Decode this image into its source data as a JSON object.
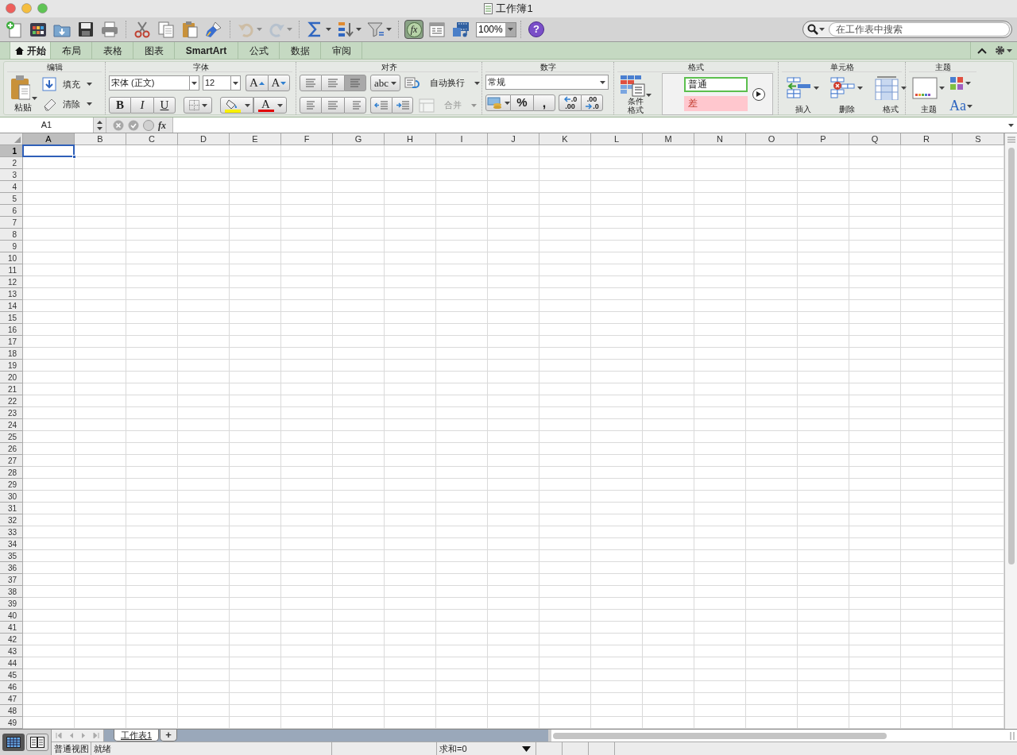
{
  "window": {
    "title": "工作簿1"
  },
  "toolbar": [
    {
      "kind": "new"
    },
    {
      "kind": "gallery"
    },
    {
      "kind": "open"
    },
    {
      "kind": "save"
    },
    {
      "kind": "print"
    },
    {
      "kind": "separator"
    },
    {
      "kind": "cut"
    },
    {
      "kind": "copy"
    },
    {
      "kind": "paste"
    },
    {
      "kind": "painter"
    },
    {
      "kind": "separator"
    },
    {
      "kind": "undo",
      "disabled": true
    },
    {
      "kind": "redo",
      "disabled": true
    },
    {
      "kind": "separator"
    },
    {
      "kind": "sum"
    },
    {
      "kind": "sort"
    },
    {
      "kind": "filter"
    },
    {
      "kind": "separator"
    },
    {
      "kind": "formula",
      "label": "fx",
      "on": true
    },
    {
      "kind": "toolbox"
    },
    {
      "kind": "media"
    },
    {
      "kind": "zoom",
      "value": "100%"
    },
    {
      "kind": "separator"
    },
    {
      "kind": "help",
      "label": "?"
    }
  ],
  "search": {
    "placeholder": "在工作表中搜索"
  },
  "tabs": [
    {
      "label": "开始",
      "selected": true
    },
    {
      "label": "布局",
      "selected": false
    },
    {
      "label": "表格",
      "selected": false
    },
    {
      "label": "图表",
      "selected": false
    },
    {
      "label": "SmartArt",
      "selected": false
    },
    {
      "label": "公式",
      "selected": false
    },
    {
      "label": "数据",
      "selected": false
    },
    {
      "label": "审阅",
      "selected": false
    }
  ],
  "ribbon": [
    {
      "kind": "edit",
      "label": "编辑",
      "paste": "粘贴",
      "fill": "填充",
      "clear": "清除"
    },
    {
      "kind": "font",
      "label": "字体",
      "font_name": "宋体 (正文)",
      "font_size": "12",
      "grow": "A",
      "shrink": "A",
      "bold": "B",
      "italic": "I",
      "underline": "U",
      "font_color": "A"
    },
    {
      "kind": "align",
      "label": "对齐",
      "vertical": [
        {
          "selected": false
        },
        {
          "selected": false
        },
        {
          "selected": true
        }
      ],
      "orientation": "abc",
      "wrap": "自动换行",
      "merge": "合并",
      "merge_disabled": true
    },
    {
      "kind": "number",
      "label": "数字",
      "format": "常规",
      "percent": "%",
      "comma": ",",
      "decrease_decimal": [
        ".0",
        ".00"
      ],
      "increase_decimal": [
        ".00",
        ".0"
      ]
    },
    {
      "kind": "styles",
      "label": "格式",
      "conditional": "条件格式",
      "styles": [
        {
          "kind": "normal",
          "label": "普通"
        },
        {
          "kind": "bad",
          "label": "差"
        }
      ]
    },
    {
      "kind": "cells",
      "label": "单元格",
      "insert": "插入",
      "delete": "删除",
      "format": "格式"
    },
    {
      "kind": "themes",
      "label": "主题",
      "themes": "主题",
      "fonts": "Aa"
    }
  ],
  "formula_bar": {
    "name_box": "A1",
    "fx": "fx"
  },
  "columns": [
    {
      "label": "A",
      "selected": true
    },
    {
      "label": "B",
      "selected": false
    },
    {
      "label": "C",
      "selected": false
    },
    {
      "label": "D",
      "selected": false
    },
    {
      "label": "E",
      "selected": false
    },
    {
      "label": "F",
      "selected": false
    },
    {
      "label": "G",
      "selected": false
    },
    {
      "label": "H",
      "selected": false
    },
    {
      "label": "I",
      "selected": false
    },
    {
      "label": "J",
      "selected": false
    },
    {
      "label": "K",
      "selected": false
    },
    {
      "label": "L",
      "selected": false
    },
    {
      "label": "M",
      "selected": false
    },
    {
      "label": "N",
      "selected": false
    },
    {
      "label": "O",
      "selected": false
    },
    {
      "label": "P",
      "selected": false
    },
    {
      "label": "Q",
      "selected": false
    },
    {
      "label": "R",
      "selected": false
    },
    {
      "label": "S",
      "selected": false
    }
  ],
  "rows": [
    {
      "label": "1",
      "selected": true
    },
    {
      "label": "2",
      "selected": false
    },
    {
      "label": "3",
      "selected": false
    },
    {
      "label": "4",
      "selected": false
    },
    {
      "label": "5",
      "selected": false
    },
    {
      "label": "6",
      "selected": false
    },
    {
      "label": "7",
      "selected": false
    },
    {
      "label": "8",
      "selected": false
    },
    {
      "label": "9",
      "selected": false
    },
    {
      "label": "10",
      "selected": false
    },
    {
      "label": "11",
      "selected": false
    },
    {
      "label": "12",
      "selected": false
    },
    {
      "label": "13",
      "selected": false
    },
    {
      "label": "14",
      "selected": false
    },
    {
      "label": "15",
      "selected": false
    },
    {
      "label": "16",
      "selected": false
    },
    {
      "label": "17",
      "selected": false
    },
    {
      "label": "18",
      "selected": false
    },
    {
      "label": "19",
      "selected": false
    },
    {
      "label": "20",
      "selected": false
    },
    {
      "label": "21",
      "selected": false
    },
    {
      "label": "22",
      "selected": false
    },
    {
      "label": "23",
      "selected": false
    },
    {
      "label": "24",
      "selected": false
    },
    {
      "label": "25",
      "selected": false
    },
    {
      "label": "26",
      "selected": false
    },
    {
      "label": "27",
      "selected": false
    },
    {
      "label": "28",
      "selected": false
    },
    {
      "label": "29",
      "selected": false
    },
    {
      "label": "30",
      "selected": false
    },
    {
      "label": "31",
      "selected": false
    },
    {
      "label": "32",
      "selected": false
    },
    {
      "label": "33",
      "selected": false
    },
    {
      "label": "34",
      "selected": false
    },
    {
      "label": "35",
      "selected": false
    },
    {
      "label": "36",
      "selected": false
    },
    {
      "label": "37",
      "selected": false
    },
    {
      "label": "38",
      "selected": false
    },
    {
      "label": "39",
      "selected": false
    },
    {
      "label": "40",
      "selected": false
    },
    {
      "label": "41",
      "selected": false
    },
    {
      "label": "42",
      "selected": false
    },
    {
      "label": "43",
      "selected": false
    },
    {
      "label": "44",
      "selected": false
    },
    {
      "label": "45",
      "selected": false
    },
    {
      "label": "46",
      "selected": false
    },
    {
      "label": "47",
      "selected": false
    },
    {
      "label": "48",
      "selected": false
    },
    {
      "label": "49",
      "selected": false
    }
  ],
  "sheet_tabs": [
    {
      "label": "工作表1",
      "selected": true
    }
  ],
  "add_sheet": "+",
  "status_bar": {
    "view": "普通视图",
    "status": "就绪",
    "sum": "求和=0"
  }
}
